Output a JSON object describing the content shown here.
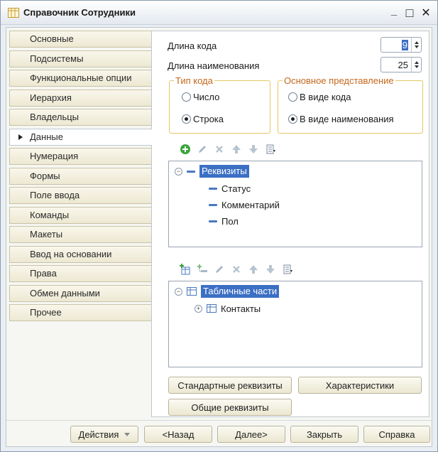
{
  "window": {
    "title": "Справочник Сотрудники",
    "minimize": "_",
    "maximize": "□",
    "close": "✕"
  },
  "tabs": [
    {
      "label": "Основные",
      "active": false
    },
    {
      "label": "Подсистемы",
      "active": false
    },
    {
      "label": "Функциональные опции",
      "active": false
    },
    {
      "label": "Иерархия",
      "active": false
    },
    {
      "label": "Владельцы",
      "active": false
    },
    {
      "label": "Данные",
      "active": true
    },
    {
      "label": "Нумерация",
      "active": false
    },
    {
      "label": "Формы",
      "active": false
    },
    {
      "label": "Поле ввода",
      "active": false
    },
    {
      "label": "Команды",
      "active": false
    },
    {
      "label": "Макеты",
      "active": false
    },
    {
      "label": "Ввод на основании",
      "active": false
    },
    {
      "label": "Права",
      "active": false
    },
    {
      "label": "Обмен данными",
      "active": false
    },
    {
      "label": "Прочее",
      "active": false
    }
  ],
  "data_tab": {
    "code_length_label": "Длина кода",
    "code_length_value": "9",
    "name_length_label": "Длина наименования",
    "name_length_value": "25",
    "code_type": {
      "legend": "Тип кода",
      "options": [
        {
          "label": "Число",
          "selected": false
        },
        {
          "label": "Строка",
          "selected": true
        }
      ]
    },
    "main_presentation": {
      "legend": "Основное представление",
      "options": [
        {
          "label": "В виде кода",
          "selected": false
        },
        {
          "label": "В виде наименования",
          "selected": true
        }
      ]
    },
    "attributes_tree": {
      "root": "Реквизиты",
      "children": [
        "Статус",
        "Комментарий",
        "Пол"
      ]
    },
    "tabular_tree": {
      "root": "Табличные части",
      "children": [
        "Контакты"
      ]
    },
    "buttons": {
      "standard_attributes": "Стандартные реквизиты",
      "characteristics": "Характеристики",
      "common_attributes": "Общие реквизиты"
    }
  },
  "footer": {
    "actions": "Действия",
    "back": "<Назад",
    "next": "Далее>",
    "close": "Закрыть",
    "help": "Справка"
  },
  "colors": {
    "accent_selection": "#3b6fc4",
    "group_legend": "#c5671a",
    "add_icon": "#3aa63a"
  }
}
